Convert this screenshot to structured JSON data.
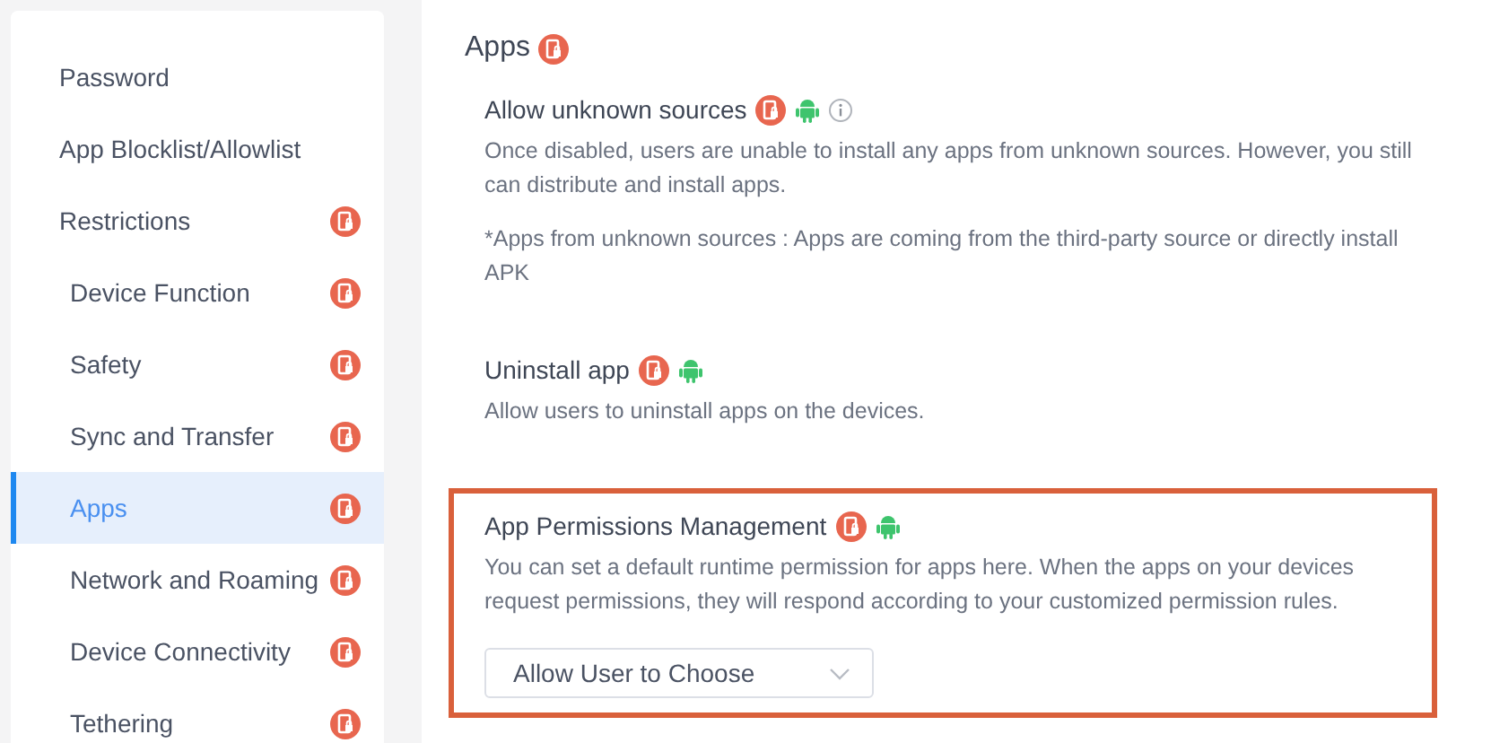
{
  "sidebar": {
    "items": [
      {
        "label": "Password",
        "sub": false,
        "locked": false,
        "selected": false
      },
      {
        "label": "App Blocklist/Allowlist",
        "sub": false,
        "locked": false,
        "selected": false
      },
      {
        "label": "Restrictions",
        "sub": false,
        "locked": true,
        "selected": false
      },
      {
        "label": "Device Function",
        "sub": true,
        "locked": true,
        "selected": false
      },
      {
        "label": "Safety",
        "sub": true,
        "locked": true,
        "selected": false
      },
      {
        "label": "Sync and Transfer",
        "sub": true,
        "locked": true,
        "selected": false
      },
      {
        "label": "Apps",
        "sub": true,
        "locked": true,
        "selected": true
      },
      {
        "label": "Network and Roaming",
        "sub": true,
        "locked": true,
        "selected": false
      },
      {
        "label": "Device Connectivity",
        "sub": true,
        "locked": true,
        "selected": false
      },
      {
        "label": "Tethering",
        "sub": true,
        "locked": true,
        "selected": false
      }
    ]
  },
  "section": {
    "title": "Apps",
    "locked": true,
    "settings": [
      {
        "title": "Allow unknown sources",
        "badges": [
          {
            "kind": "lock"
          },
          {
            "kind": "android"
          },
          {
            "kind": "info"
          }
        ],
        "highlighted": false,
        "paragraphs": [
          "Once disabled, users are unable to install any apps from unknown sources. However, you still can distribute and install apps.",
          "*Apps from unknown sources : Apps are coming from the third-party source or directly install APK"
        ]
      },
      {
        "title": "Uninstall app",
        "badges": [
          {
            "kind": "lock"
          },
          {
            "kind": "android"
          }
        ],
        "highlighted": false,
        "paragraphs": [
          "Allow users to uninstall apps on the devices."
        ]
      },
      {
        "title": "App Permissions Management",
        "badges": [
          {
            "kind": "lock"
          },
          {
            "kind": "android"
          }
        ],
        "highlighted": true,
        "paragraphs": [
          "You can set a default runtime permission for apps here. When the apps on your devices request permissions, they will respond according to your customized permission rules."
        ],
        "select": {
          "value": "Allow User to Choose"
        }
      }
    ]
  }
}
